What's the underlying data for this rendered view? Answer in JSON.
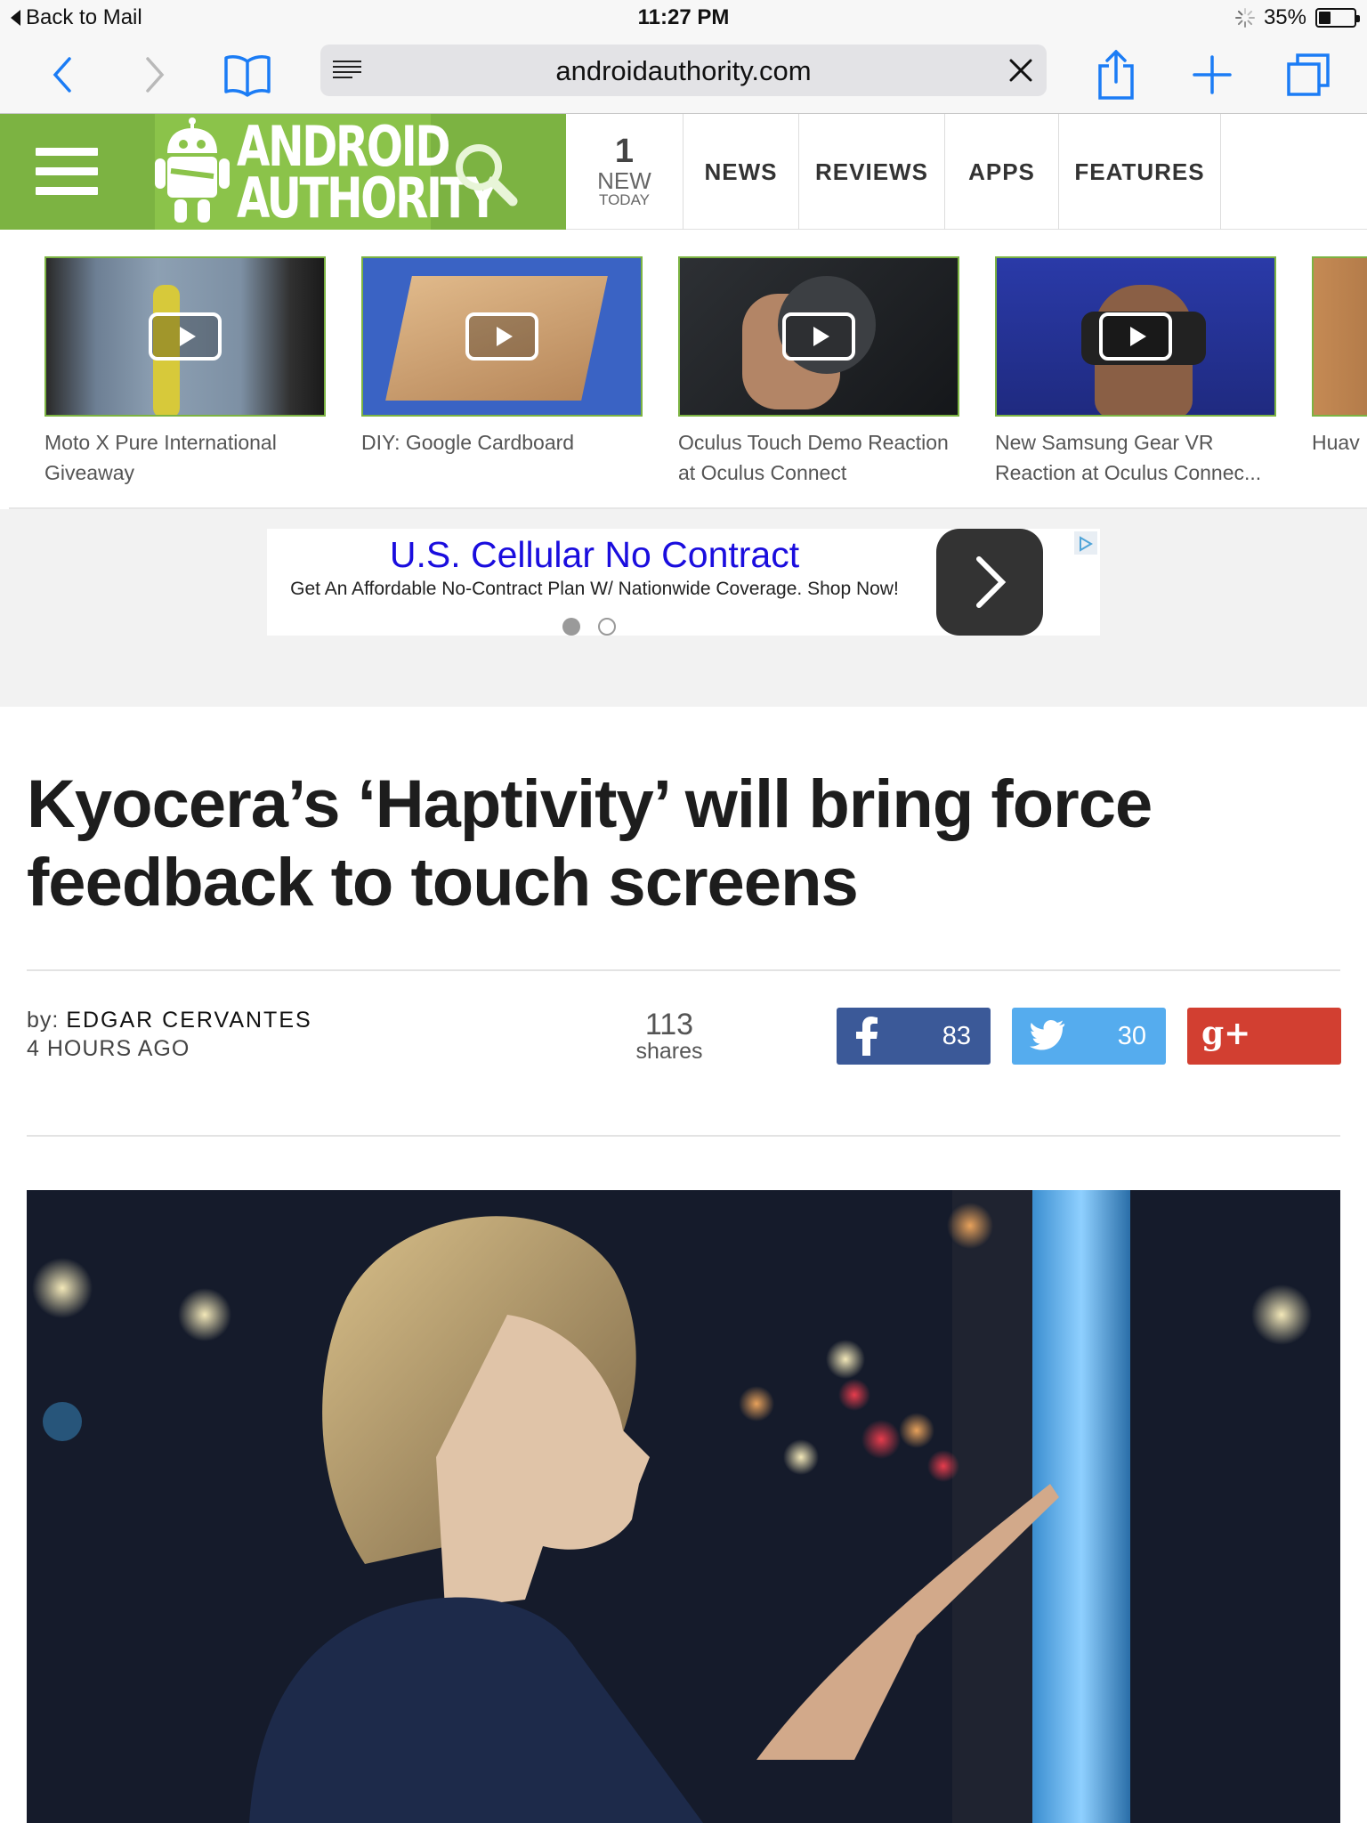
{
  "status_bar": {
    "back_label": "Back to Mail",
    "time": "11:27 PM",
    "battery": "35%",
    "battery_level": 0.35
  },
  "browser": {
    "url": "androidauthority.com",
    "icons": [
      "back-arrow-icon",
      "forward-arrow-icon",
      "bookmarks-icon",
      "reader-icon",
      "clear-icon",
      "share-icon",
      "new-tab-icon",
      "tabs-icon"
    ]
  },
  "site_header": {
    "logo_line1": "ANDROID",
    "logo_line2": "AUTHORITY",
    "new_count": "1",
    "new_label": "NEW",
    "today_label": "TODAY",
    "nav": [
      "NEWS",
      "REVIEWS",
      "APPS",
      "FEATURES"
    ],
    "brand_color": "#7cb342"
  },
  "videos": [
    {
      "title": "Moto X Pure International Giveaway"
    },
    {
      "title": "DIY: Google Cardboard"
    },
    {
      "title": "Oculus Touch Demo Reaction at Oculus Connect"
    },
    {
      "title": "New Samsung Gear VR Reaction at Oculus Connec..."
    },
    {
      "title": "Huav Initia"
    }
  ],
  "ad": {
    "title": "U.S. Cellular No Contract",
    "description": "Get An Affordable No-Contract Plan W/ Nationwide Coverage. Shop Now!"
  },
  "article": {
    "headline": "Kyocera’s ‘Haptivity’ will bring force feedback to touch screens",
    "by_label": "by:",
    "author": "EDGAR CERVANTES",
    "time_ago": "4 HOURS AGO",
    "share_count": "113",
    "share_label": "shares",
    "social": [
      {
        "network": "facebook",
        "icon": "facebook-icon",
        "count": "83",
        "color": "#3b5998"
      },
      {
        "network": "twitter",
        "icon": "twitter-icon",
        "count": "30",
        "color": "#55acee"
      },
      {
        "network": "google-plus",
        "icon": "google-plus-icon",
        "count": "",
        "color": "#d23f31"
      }
    ]
  }
}
